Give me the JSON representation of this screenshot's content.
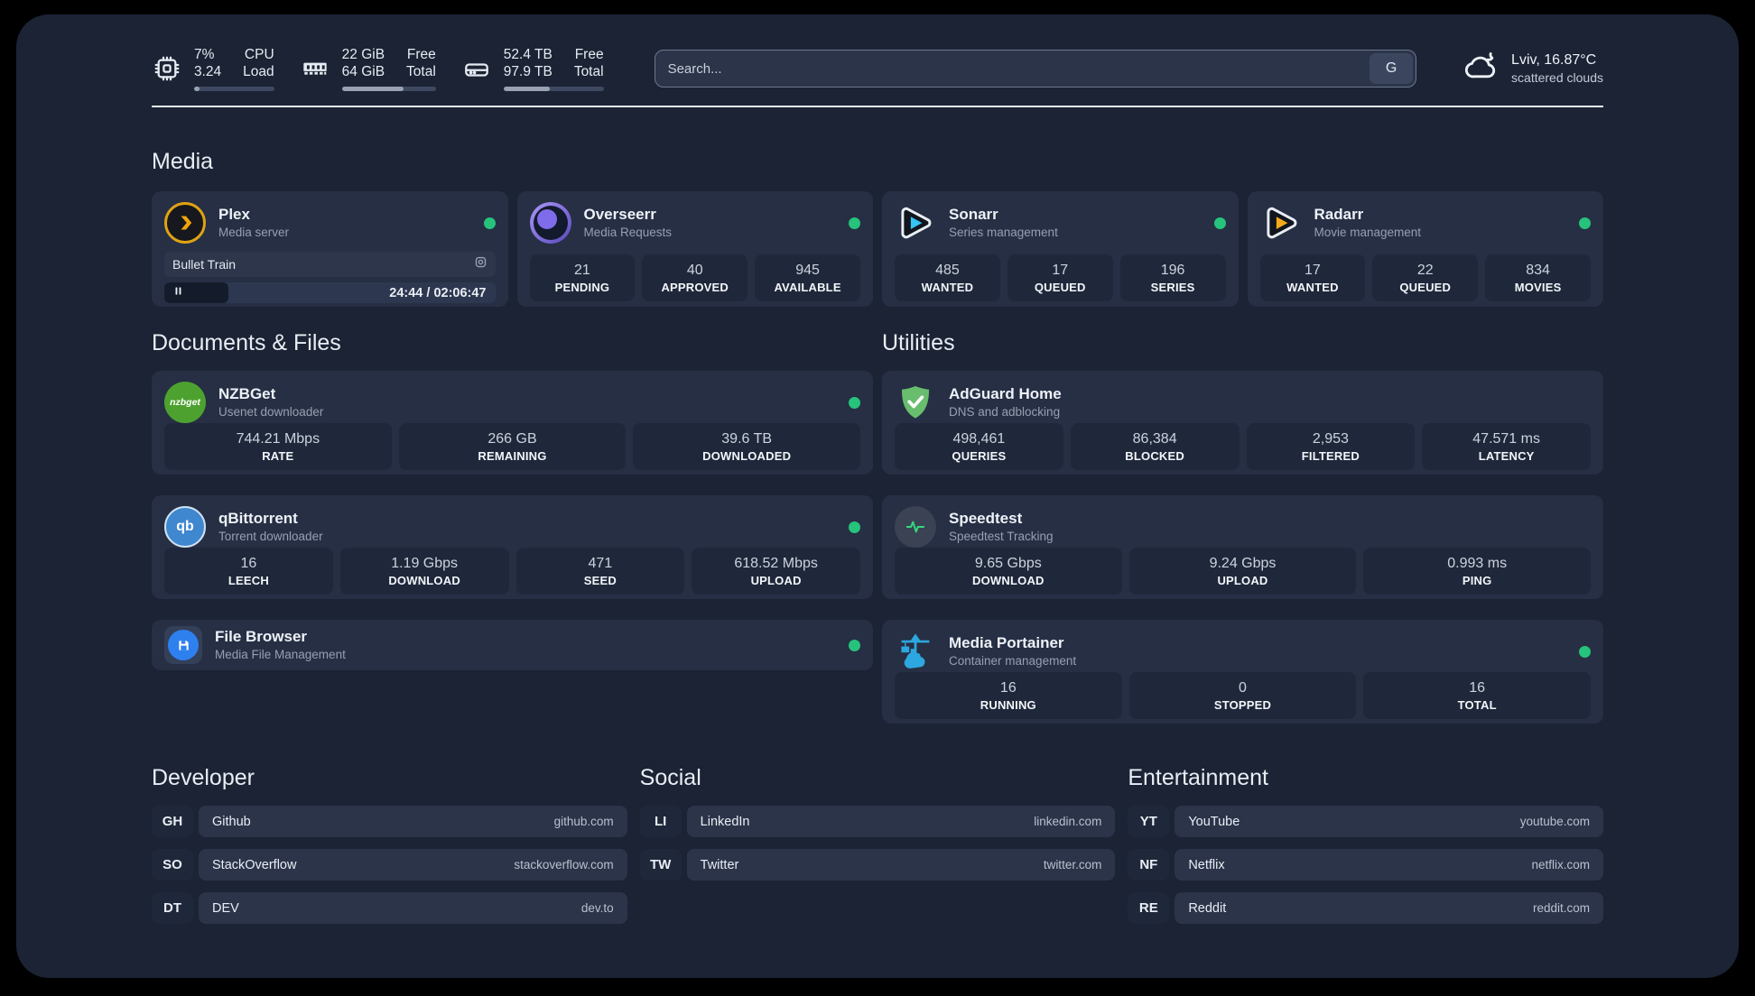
{
  "header": {
    "system_stats": [
      {
        "icon": "cpu-icon",
        "value_top": "7%",
        "value_bottom": "3.24",
        "label_top": "CPU",
        "label_bottom": "Load",
        "progress_pct": 7
      },
      {
        "icon": "ram-icon",
        "value_top": "22 GiB",
        "value_bottom": "64 GiB",
        "label_top": "Free",
        "label_bottom": "Total",
        "progress_pct": 66
      },
      {
        "icon": "disk-icon",
        "value_top": "52.4 TB",
        "value_bottom": "97.9 TB",
        "label_top": "Free",
        "label_bottom": "Total",
        "progress_pct": 46
      }
    ],
    "search": {
      "placeholder": "Search...",
      "engine_button": "G"
    },
    "weather": {
      "icon": "cloud-icon",
      "location": "Lviv, 16.87°C",
      "condition": "scattered clouds"
    }
  },
  "sections": {
    "media": {
      "title": "Media",
      "apps": [
        {
          "name": "Plex",
          "subtitle": "Media server",
          "icon": "plex-icon",
          "has_status_dot": true,
          "player": {
            "title": "Bullet Train",
            "time": "24:44 / 02:06:47",
            "progress_pct": 19.5
          }
        },
        {
          "name": "Overseerr",
          "subtitle": "Media Requests",
          "icon": "overseerr-icon",
          "has_status_dot": true,
          "stats": [
            {
              "value": "21",
              "label": "PENDING"
            },
            {
              "value": "40",
              "label": "APPROVED"
            },
            {
              "value": "945",
              "label": "AVAILABLE"
            }
          ]
        },
        {
          "name": "Sonarr",
          "subtitle": "Series management",
          "icon": "sonarr-icon",
          "has_status_dot": true,
          "stats": [
            {
              "value": "485",
              "label": "WANTED"
            },
            {
              "value": "17",
              "label": "QUEUED"
            },
            {
              "value": "196",
              "label": "SERIES"
            }
          ]
        },
        {
          "name": "Radarr",
          "subtitle": "Movie management",
          "icon": "radarr-icon",
          "has_status_dot": true,
          "stats": [
            {
              "value": "17",
              "label": "WANTED"
            },
            {
              "value": "22",
              "label": "QUEUED"
            },
            {
              "value": "834",
              "label": "MOVIES"
            }
          ]
        }
      ]
    },
    "documents": {
      "title": "Documents & Files",
      "apps": [
        {
          "name": "NZBGet",
          "subtitle": "Usenet downloader",
          "icon": "nzbget-icon",
          "icon_text": "nzbget",
          "has_status_dot": true,
          "stats": [
            {
              "value": "744.21 Mbps",
              "label": "RATE"
            },
            {
              "value": "266 GB",
              "label": "REMAINING"
            },
            {
              "value": "39.6 TB",
              "label": "DOWNLOADED"
            }
          ]
        },
        {
          "name": "qBittorrent",
          "subtitle": "Torrent downloader",
          "icon": "qbittorrent-icon",
          "icon_text": "qb",
          "has_status_dot": true,
          "stats": [
            {
              "value": "16",
              "label": "LEECH"
            },
            {
              "value": "1.19 Gbps",
              "label": "DOWNLOAD"
            },
            {
              "value": "471",
              "label": "SEED"
            },
            {
              "value": "618.52 Mbps",
              "label": "UPLOAD"
            }
          ]
        },
        {
          "name": "File Browser",
          "subtitle": "Media File Management",
          "icon": "filebrowser-icon",
          "has_status_dot": true,
          "stats": []
        }
      ]
    },
    "utilities": {
      "title": "Utilities",
      "apps": [
        {
          "name": "AdGuard Home",
          "subtitle": "DNS and adblocking",
          "icon": "adguard-icon",
          "has_status_dot": false,
          "stats": [
            {
              "value": "498,461",
              "label": "QUERIES"
            },
            {
              "value": "86,384",
              "label": "BLOCKED"
            },
            {
              "value": "2,953",
              "label": "FILTERED"
            },
            {
              "value": "47.571 ms",
              "label": "LATENCY"
            }
          ]
        },
        {
          "name": "Speedtest",
          "subtitle": "Speedtest Tracking",
          "icon": "speedtest-icon",
          "has_status_dot": false,
          "stats": [
            {
              "value": "9.65 Gbps",
              "label": "DOWNLOAD"
            },
            {
              "value": "9.24 Gbps",
              "label": "UPLOAD"
            },
            {
              "value": "0.993 ms",
              "label": "PING"
            }
          ]
        },
        {
          "name": "Media Portainer",
          "subtitle": "Container management",
          "icon": "portainer-icon",
          "has_status_dot": true,
          "stats": [
            {
              "value": "16",
              "label": "RUNNING"
            },
            {
              "value": "0",
              "label": "STOPPED"
            },
            {
              "value": "16",
              "label": "TOTAL"
            }
          ]
        }
      ]
    },
    "bookmarks": [
      {
        "title": "Developer",
        "items": [
          {
            "abbr": "GH",
            "name": "Github",
            "url": "github.com"
          },
          {
            "abbr": "SO",
            "name": "StackOverflow",
            "url": "stackoverflow.com"
          },
          {
            "abbr": "DT",
            "name": "DEV",
            "url": "dev.to"
          }
        ]
      },
      {
        "title": "Social",
        "items": [
          {
            "abbr": "LI",
            "name": "LinkedIn",
            "url": "linkedin.com"
          },
          {
            "abbr": "TW",
            "name": "Twitter",
            "url": "twitter.com"
          }
        ]
      },
      {
        "title": "Entertainment",
        "items": [
          {
            "abbr": "YT",
            "name": "YouTube",
            "url": "youtube.com"
          },
          {
            "abbr": "NF",
            "name": "Netflix",
            "url": "netflix.com"
          },
          {
            "abbr": "RE",
            "name": "Reddit",
            "url": "reddit.com"
          }
        ]
      }
    ]
  },
  "colors": {
    "panel_bg": "#1b2334",
    "card_bg": "#262f44",
    "tile_bg": "#1f283a",
    "status_online": "#27c27b",
    "plex_gold": "#dfa312",
    "sonarr_blue": "#35c5f4",
    "radarr_orange": "#f6a81c",
    "adguard_green": "#68bd6e",
    "portainer_blue": "#2da7df",
    "speedtest_green": "#34d87b",
    "nzbget_green": "#4da22f",
    "qbittorrent_blue": "#3f87cf"
  }
}
